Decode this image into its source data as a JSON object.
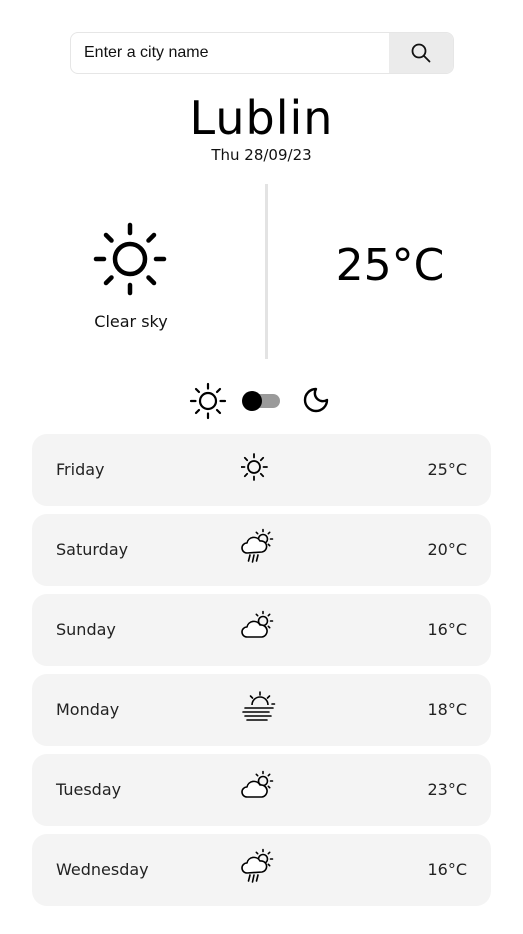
{
  "search": {
    "placeholder": "Enter a city name"
  },
  "location": {
    "city": "Lublin",
    "date": "Thu 28/09/23"
  },
  "current": {
    "icon": "sun-icon",
    "condition": "Clear sky",
    "temperature": "25°C"
  },
  "theme": {
    "light_icon": "sun-icon",
    "dark_icon": "moon-icon",
    "mode": "light"
  },
  "forecast": [
    {
      "day": "Friday",
      "icon": "sun",
      "temp": "25°C"
    },
    {
      "day": "Saturday",
      "icon": "rain",
      "temp": "20°C"
    },
    {
      "day": "Sunday",
      "icon": "partly-cloudy",
      "temp": "16°C"
    },
    {
      "day": "Monday",
      "icon": "fog",
      "temp": "18°C"
    },
    {
      "day": "Tuesday",
      "icon": "partly-cloudy",
      "temp": "23°C"
    },
    {
      "day": "Wednesday",
      "icon": "rain",
      "temp": "16°C"
    }
  ]
}
